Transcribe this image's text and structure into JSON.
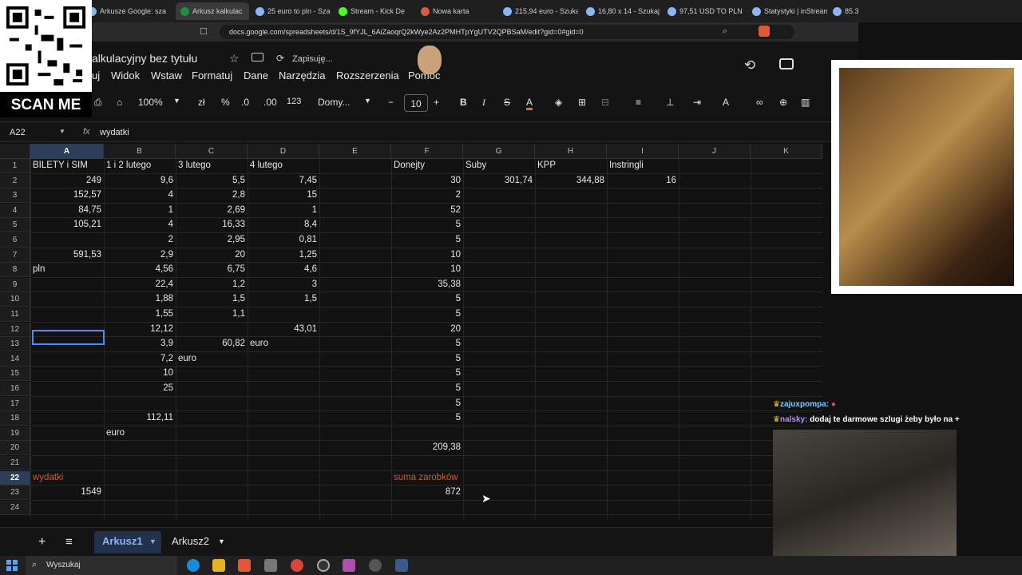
{
  "browser": {
    "tabs": [
      "Arkusze Google: sza",
      "Arkusz kalkulac",
      "25 euro to pln - Sza",
      "Stream - Kick De",
      "Nowa karta",
      "215,94 euro - Szuka",
      "16,80 x 14 - Szukaj",
      "97,51 USD TO PLN",
      "Statystyki | inStream",
      "85.3"
    ],
    "url": "docs.google.com/spreadsheets/d/1S_9fYJL_6AiZaoqrQ2kWye2Az2PMHTpYgUTV2QPBSaM/edit?gid=0#gid=0"
  },
  "sheets": {
    "title": "alkulacyjny bez tytułu",
    "saving": "Zapisuję...",
    "menu": [
      "uj",
      "Widok",
      "Wstaw",
      "Formatuj",
      "Dane",
      "Narzędzia",
      "Rozszerzenia",
      "Pomoc"
    ],
    "toolbar": {
      "zoom": "100%",
      "currency": "zł",
      "percent": "%",
      "dec_minus": ".0",
      "dec_plus": ".00",
      "num_format": "123",
      "font": "Domy...",
      "font_size": "10"
    },
    "name_box": "A22",
    "fx": "fx",
    "formula_value": "wydatki",
    "columns": [
      "A",
      "B",
      "C",
      "D",
      "E",
      "F",
      "G",
      "H",
      "I",
      "J",
      "K"
    ],
    "rows": [
      [
        "BILETY i SIM",
        "1 i 2 lutego",
        "3 lutego",
        "4 lutego",
        "",
        "Donejty",
        "Suby",
        "KPP",
        "Instringli",
        "",
        ""
      ],
      [
        "249",
        "9,6",
        "5,5",
        "7,45",
        "",
        "30",
        "301,74",
        "344,88",
        "16",
        "",
        ""
      ],
      [
        "152,57",
        "4",
        "2,8",
        "15",
        "",
        "2",
        "",
        "",
        "",
        "",
        ""
      ],
      [
        "84,75",
        "1",
        "2,69",
        "1",
        "",
        "52",
        "",
        "",
        "",
        "",
        ""
      ],
      [
        "105,21",
        "4",
        "16,33",
        "8,4",
        "",
        "5",
        "",
        "",
        "",
        "",
        ""
      ],
      [
        "",
        "2",
        "2,95",
        "0,81",
        "",
        "5",
        "",
        "",
        "",
        "",
        ""
      ],
      [
        "591,53",
        "2,9",
        "20",
        "1,25",
        "",
        "10",
        "",
        "",
        "",
        "",
        ""
      ],
      [
        "pln",
        "4,56",
        "6,75",
        "4,6",
        "",
        "10",
        "",
        "",
        "",
        "",
        ""
      ],
      [
        "",
        "22,4",
        "1,2",
        "3",
        "",
        "35,38",
        "",
        "",
        "",
        "",
        ""
      ],
      [
        "",
        "1,88",
        "1,5",
        "1,5",
        "",
        "5",
        "",
        "",
        "",
        "",
        ""
      ],
      [
        "",
        "1,55",
        "1,1",
        "",
        "",
        "5",
        "",
        "",
        "",
        "",
        ""
      ],
      [
        "",
        "12,12",
        "",
        "43,01",
        "",
        "20",
        "",
        "",
        "",
        "",
        ""
      ],
      [
        "",
        "3,9",
        "60,82",
        "euro",
        "",
        "5",
        "",
        "",
        "",
        "",
        ""
      ],
      [
        "",
        "7,2",
        "euro",
        "",
        "",
        "5",
        "",
        "",
        "",
        "",
        ""
      ],
      [
        "",
        "10",
        "",
        "",
        "",
        "5",
        "",
        "",
        "",
        "",
        ""
      ],
      [
        "",
        "25",
        "",
        "",
        "",
        "5",
        "",
        "",
        "",
        "",
        ""
      ],
      [
        "",
        "",
        "",
        "",
        "",
        "5",
        "",
        "",
        "",
        "",
        ""
      ],
      [
        "",
        "112,11",
        "",
        "",
        "",
        "5",
        "",
        "",
        "",
        "",
        ""
      ],
      [
        "",
        "euro",
        "",
        "",
        "",
        "",
        "",
        "",
        "",
        "",
        ""
      ],
      [
        "",
        "",
        "",
        "",
        "",
        "209,38",
        "",
        "",
        "",
        "",
        ""
      ],
      [
        "",
        "",
        "",
        "",
        "",
        "",
        "",
        "",
        "",
        "",
        ""
      ],
      [
        "wydatki",
        "",
        "",
        "",
        "",
        "suma zarobków",
        "",
        "",
        "",
        "",
        ""
      ],
      [
        "1549",
        "",
        "",
        "",
        "",
        "872",
        "",
        "",
        "",
        "",
        ""
      ],
      [
        "",
        "",
        "",
        "",
        "",
        "",
        "",
        "",
        "",
        "",
        ""
      ]
    ],
    "row_numbers": [
      "1",
      "2",
      "3",
      "4",
      "5",
      "6",
      "7",
      "8",
      "9",
      "10",
      "11",
      "12",
      "13",
      "14",
      "15",
      "16",
      "17",
      "18",
      "19",
      "20",
      "21",
      "22",
      "23",
      "24"
    ],
    "sheet_tabs": [
      "Arkusz1",
      "Arkusz2"
    ],
    "accent_color": "#8ab4f8",
    "highlight_text_color": "#c0603a"
  },
  "overlay": {
    "scan_me": "SCAN ME",
    "chat": [
      {
        "user": "zajuxpompa:",
        "message": "",
        "user_color": "#7ec8ff"
      },
      {
        "user": "nalsky:",
        "message": "dodaj te darmowe szlugi żeby było na +",
        "user_color": "#b48cff"
      }
    ]
  },
  "taskbar": {
    "search": "Wyszukaj"
  }
}
